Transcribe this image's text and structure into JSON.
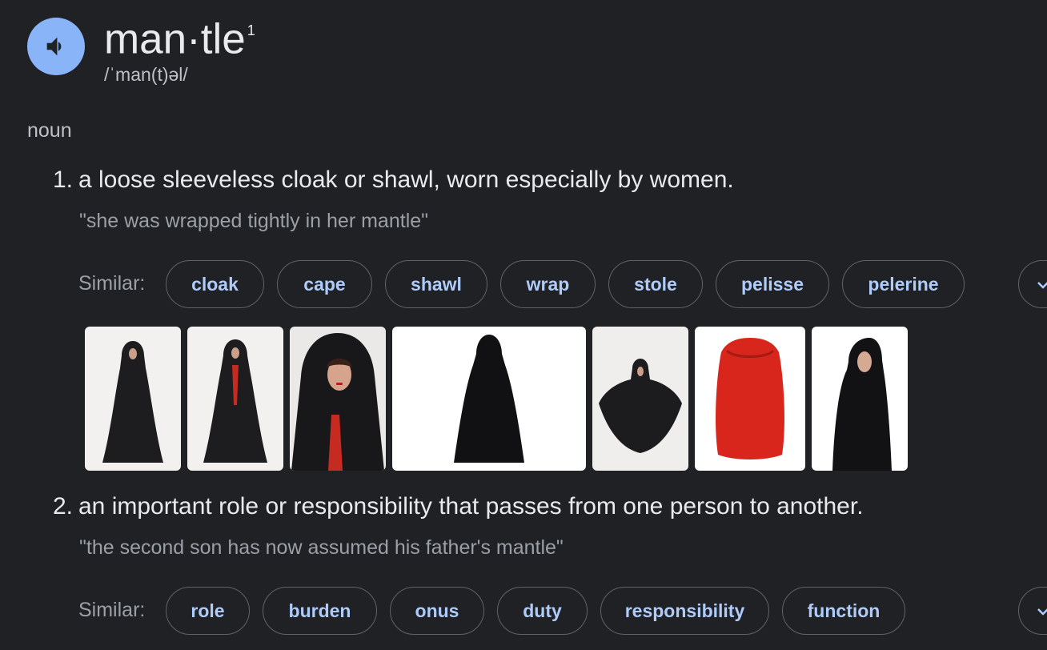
{
  "entry": {
    "word": "man·tle",
    "superscript": "1",
    "phonetic": "/ˈman(t)əl/",
    "part_of_speech": "noun"
  },
  "senses": [
    {
      "number": "1.",
      "definition": "a loose sleeveless cloak or shawl, worn especially by women.",
      "example": "\"she was wrapped tightly in her mantle\"",
      "similar_label": "Similar:",
      "similar": [
        "cloak",
        "cape",
        "shawl",
        "wrap",
        "stole",
        "pelisse",
        "pelerine"
      ]
    },
    {
      "number": "2.",
      "definition": "an important role or responsibility that passes from one person to another.",
      "example": "\"the second son has now assumed his father's mantle\"",
      "similar_label": "Similar:",
      "similar": [
        "role",
        "burden",
        "onus",
        "duty",
        "responsibility",
        "function"
      ]
    }
  ],
  "images": [
    {
      "icon": "black-cloak-figure",
      "colors": {
        "bg": "#f2f1ef",
        "cloak": "#1d1d1f",
        "lining": "#3a2a28"
      }
    },
    {
      "icon": "black-cloak-red-lining",
      "colors": {
        "bg": "#f2f1ef",
        "cloak": "#1d1d1f",
        "lining": "#c62b22"
      }
    },
    {
      "icon": "hooded-face-closeup",
      "colors": {
        "bg": "#ebe9e7",
        "cloak": "#18181a",
        "lining": "#c62b22"
      }
    },
    {
      "icon": "black-cloak-product",
      "colors": {
        "bg": "#ffffff",
        "cloak": "#111113"
      }
    },
    {
      "icon": "cloak-spread-arms",
      "colors": {
        "bg": "#efeeec",
        "cloak": "#1c1c1e"
      }
    },
    {
      "icon": "red-cape-product",
      "colors": {
        "bg": "#ffffff",
        "cloak": "#d8261c"
      }
    },
    {
      "icon": "side-hooded-figure",
      "colors": {
        "bg": "#ffffff",
        "cloak": "#121214"
      }
    }
  ],
  "colors": {
    "background": "#202124",
    "speaker_button": "#8ab4f8",
    "chip_text": "#aecbfa",
    "chip_border": "#5f6368"
  }
}
